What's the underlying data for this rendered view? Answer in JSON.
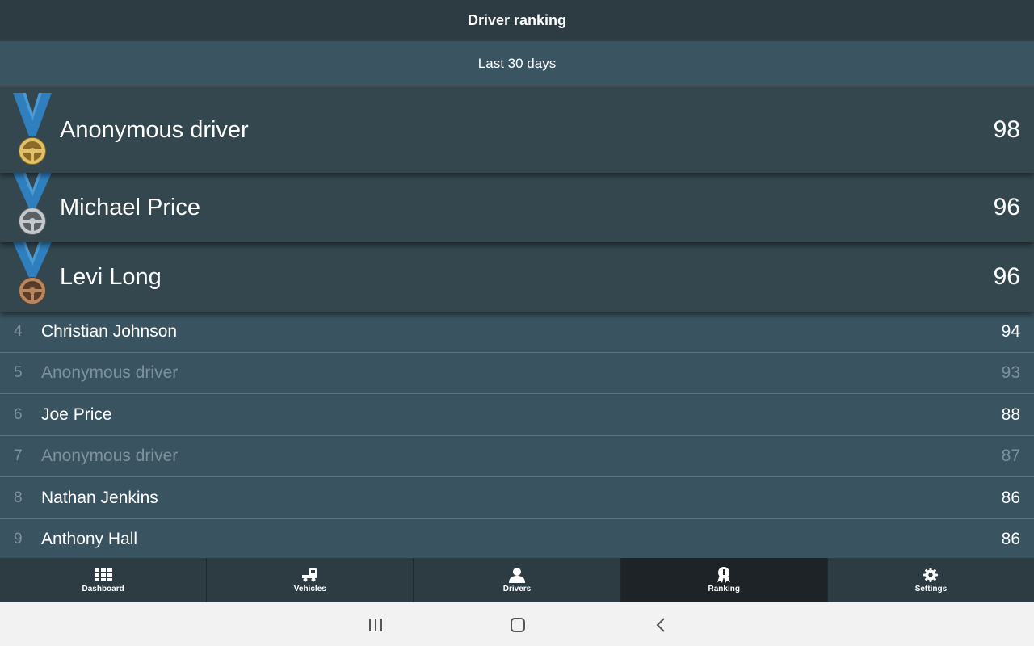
{
  "header": {
    "title": "Driver ranking"
  },
  "period": {
    "label": "Last 30 days"
  },
  "podium": [
    {
      "medal": "gold-medal-icon",
      "name": "Anonymous driver",
      "score": "98"
    },
    {
      "medal": "silver-medal-icon",
      "name": "Michael Price",
      "score": "96"
    },
    {
      "medal": "bronze-medal-icon",
      "name": "Levi Long",
      "score": "96"
    }
  ],
  "rankings": [
    {
      "rank": "4",
      "name": "Christian Johnson",
      "score": "94",
      "anonymous": false
    },
    {
      "rank": "5",
      "name": "Anonymous driver",
      "score": "93",
      "anonymous": true
    },
    {
      "rank": "6",
      "name": "Joe Price",
      "score": "88",
      "anonymous": false
    },
    {
      "rank": "7",
      "name": "Anonymous driver",
      "score": "87",
      "anonymous": true
    },
    {
      "rank": "8",
      "name": "Nathan Jenkins",
      "score": "86",
      "anonymous": false
    },
    {
      "rank": "9",
      "name": "Anthony Hall",
      "score": "86",
      "anonymous": false
    }
  ],
  "tabs": [
    {
      "label": "Dashboard",
      "icon": "grid-icon",
      "active": false
    },
    {
      "label": "Vehicles",
      "icon": "truck-icon",
      "active": false
    },
    {
      "label": "Drivers",
      "icon": "person-icon",
      "active": false
    },
    {
      "label": "Ranking",
      "icon": "award-icon",
      "active": true
    },
    {
      "label": "Settings",
      "icon": "gear-icon",
      "active": false
    }
  ],
  "system_nav": {
    "recents": "recents-icon",
    "home": "home-icon",
    "back": "back-icon"
  },
  "colors": {
    "header_bg": "#2d3b43",
    "period_bg": "#3b5461",
    "row_bg": "#3a5361",
    "podium_bg": "#34474f",
    "ribbon": "#2f7fbf",
    "gold": "#c9a24a",
    "silver": "#a9aeb3",
    "bronze": "#a0714d",
    "active_tab": "#1d2326"
  }
}
